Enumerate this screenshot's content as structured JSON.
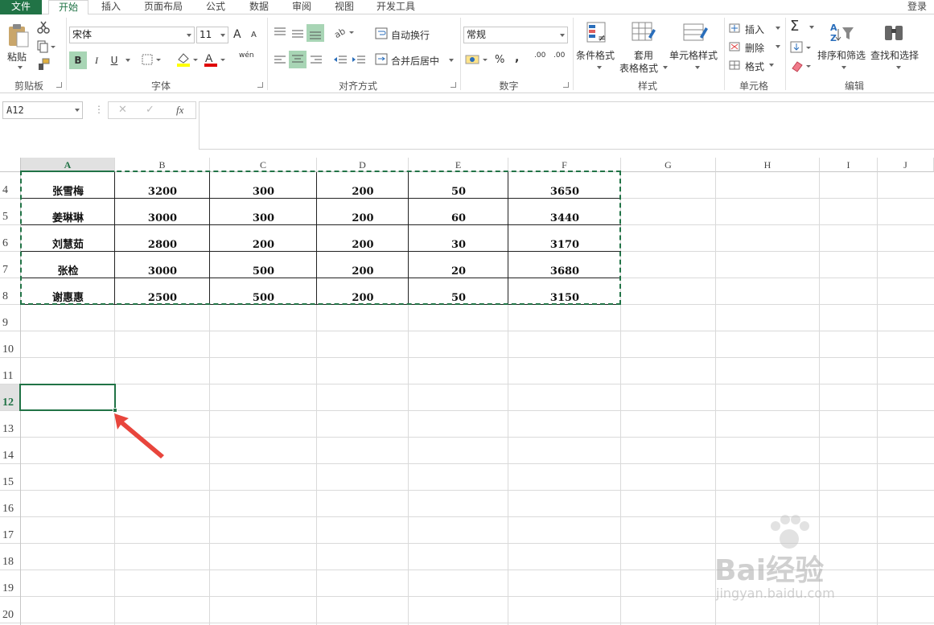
{
  "menu": {
    "tabs": [
      "文件",
      "开始",
      "插入",
      "页面布局",
      "公式",
      "数据",
      "审阅",
      "视图",
      "开发工具"
    ],
    "login": "登录"
  },
  "ribbon": {
    "clipboard": {
      "paste": "粘贴",
      "label": "剪贴板"
    },
    "font": {
      "name": "宋体",
      "size": "11",
      "bold": "B",
      "italic": "I",
      "underline": "U",
      "phonetic": "wén",
      "grow": "A",
      "shrink": "A",
      "label": "字体"
    },
    "alignment": {
      "wrap": "自动换行",
      "merge": "合并后居中",
      "label": "对齐方式"
    },
    "number": {
      "format": "常规",
      "percent": "%",
      "comma": ",",
      "inc_decimal": ".00",
      "dec_decimal": ".00",
      "label": "数字"
    },
    "styles": {
      "conditional": "条件格式",
      "table_fmt_1": "套用",
      "table_fmt_2": "表格格式",
      "cell_styles": "单元格样式",
      "label": "样式"
    },
    "cells": {
      "insert": "插入",
      "delete": "删除",
      "format": "格式",
      "label": "单元格"
    },
    "editing": {
      "sum": "Σ",
      "sort_filter": "排序和筛选",
      "find_select": "查找和选择",
      "label": "编辑"
    }
  },
  "formula_bar": {
    "name_box": "A12",
    "cancel": "✕",
    "enter": "✓",
    "fx": "fx",
    "formula": ""
  },
  "columns": [
    "A",
    "B",
    "C",
    "D",
    "E",
    "F",
    "G",
    "H",
    "I",
    "J"
  ],
  "rows": [
    "4",
    "5",
    "6",
    "7",
    "8",
    "9",
    "10",
    "11",
    "12",
    "13",
    "14",
    "15",
    "16",
    "17",
    "18",
    "19",
    "20"
  ],
  "table": [
    [
      "张雪梅",
      "3200",
      "300",
      "200",
      "50",
      "3650"
    ],
    [
      "姜琳琳",
      "3000",
      "300",
      "200",
      "60",
      "3440"
    ],
    [
      "刘慧茹",
      "2800",
      "200",
      "200",
      "30",
      "3170"
    ],
    [
      "张检",
      "3000",
      "500",
      "200",
      "20",
      "3680"
    ],
    [
      "谢惠惠",
      "2500",
      "500",
      "200",
      "50",
      "3150"
    ]
  ],
  "selected_cell": "A12",
  "watermark": {
    "brand": "Bai经验",
    "url": "jingyan.baidu.com"
  },
  "colors": {
    "accent": "#217346",
    "arrow": "#e8453c"
  }
}
